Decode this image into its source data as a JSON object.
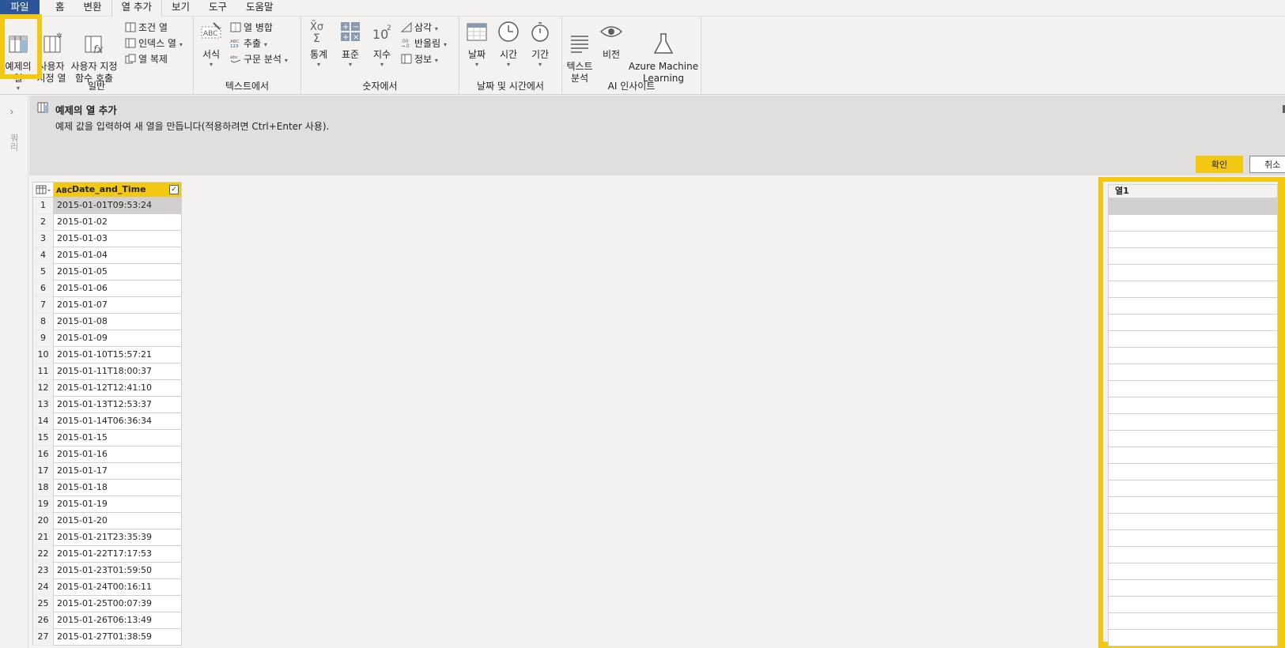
{
  "menu": {
    "tabs": [
      "파일",
      "홈",
      "변환",
      "열 추가",
      "보기",
      "도구",
      "도움말"
    ],
    "active": "열 추가"
  },
  "ribbon": {
    "general": {
      "label": "일반",
      "column_from_examples": "예제의\n열",
      "custom_column": "사용자\n지정 열",
      "invoke_custom_function": "사용자 지정\n함수 호출",
      "conditional_column": "조건 열",
      "index_column": "인덱스 열",
      "duplicate_column": "열 복제"
    },
    "from_text": {
      "label": "텍스트에서",
      "format": "서식",
      "merge_columns": "열 병합",
      "extract": "추출",
      "parse": "구문 분석"
    },
    "from_number": {
      "label": "숫자에서",
      "statistics": "통계",
      "standard": "표준",
      "scientific": "지수",
      "trigonometry": "삼각",
      "rounding": "반올림",
      "information": "정보"
    },
    "from_date_time": {
      "label": "날짜 및 시간에서",
      "date": "날짜",
      "time": "시간",
      "duration": "기간"
    },
    "ai_insights": {
      "label": "AI 인사이트",
      "text_analytics": "텍스트\n분석",
      "vision": "비전",
      "azure_ml": "Azure Machine\nLearning"
    }
  },
  "rail": {
    "label": "쿼리"
  },
  "pane": {
    "title": "예제의 열 추가",
    "description": "예제 값을 입력하여 새 열을 만듭니다(적용하려면 Ctrl+Enter 사용).",
    "ok_label": "확인",
    "cancel_label": "취소"
  },
  "grid": {
    "column_header": "Date_and_Time",
    "type_icon": "ABC",
    "rows": [
      {
        "n": "1",
        "v": "2015-01-01T09:53:24"
      },
      {
        "n": "2",
        "v": "2015-01-02"
      },
      {
        "n": "3",
        "v": "2015-01-03"
      },
      {
        "n": "4",
        "v": "2015-01-04"
      },
      {
        "n": "5",
        "v": "2015-01-05"
      },
      {
        "n": "6",
        "v": "2015-01-06"
      },
      {
        "n": "7",
        "v": "2015-01-07"
      },
      {
        "n": "8",
        "v": "2015-01-08"
      },
      {
        "n": "9",
        "v": "2015-01-09"
      },
      {
        "n": "10",
        "v": "2015-01-10T15:57:21"
      },
      {
        "n": "11",
        "v": "2015-01-11T18:00:37"
      },
      {
        "n": "12",
        "v": "2015-01-12T12:41:10"
      },
      {
        "n": "13",
        "v": "2015-01-13T12:53:37"
      },
      {
        "n": "14",
        "v": "2015-01-14T06:36:34"
      },
      {
        "n": "15",
        "v": "2015-01-15"
      },
      {
        "n": "16",
        "v": "2015-01-16"
      },
      {
        "n": "17",
        "v": "2015-01-17"
      },
      {
        "n": "18",
        "v": "2015-01-18"
      },
      {
        "n": "19",
        "v": "2015-01-19"
      },
      {
        "n": "20",
        "v": "2015-01-20"
      },
      {
        "n": "21",
        "v": "2015-01-21T23:35:39"
      },
      {
        "n": "22",
        "v": "2015-01-22T17:17:53"
      },
      {
        "n": "23",
        "v": "2015-01-23T01:59:50"
      },
      {
        "n": "24",
        "v": "2015-01-24T00:16:11"
      },
      {
        "n": "25",
        "v": "2015-01-25T00:07:39"
      },
      {
        "n": "26",
        "v": "2015-01-26T06:13:49"
      },
      {
        "n": "27",
        "v": "2015-01-27T01:38:59"
      }
    ]
  },
  "example_column": {
    "header": "열1"
  },
  "colors": {
    "highlight": "#f2c811",
    "file_tab": "#2b579a",
    "selected_row": "#d2d0ce"
  }
}
